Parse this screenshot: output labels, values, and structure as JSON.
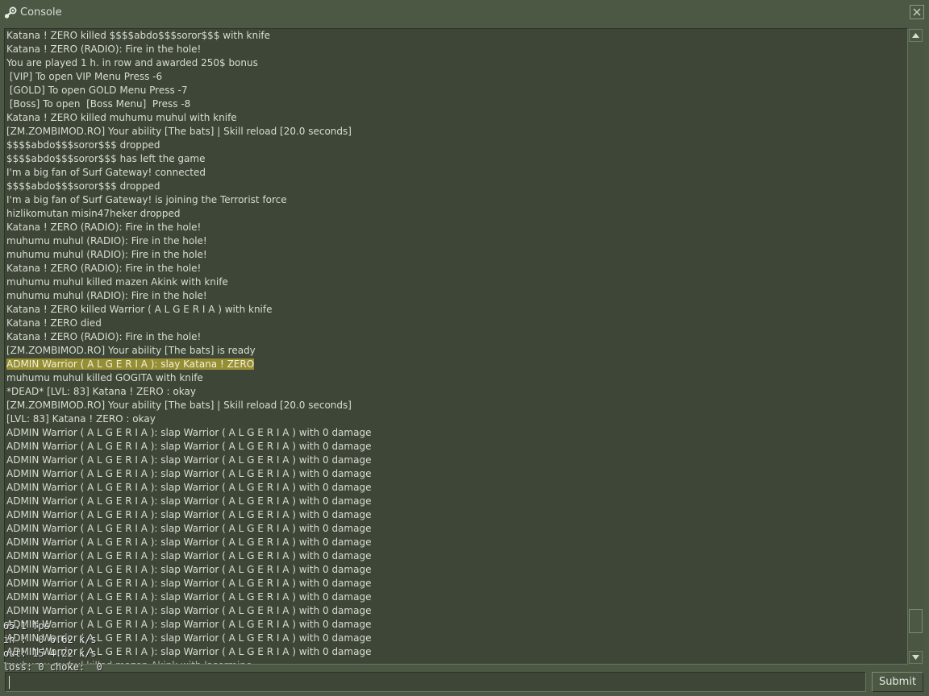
{
  "window": {
    "title": "Console",
    "title_icon": "steam-icon",
    "close_icon": "close-icon"
  },
  "log": {
    "highlight_color": "#958e34",
    "lines": [
      "Katana ! ZERO killed $$$$abdo$$$soror$$$ with knife",
      "Katana ! ZERO (RADIO): Fire in the hole!",
      "You are played 1 h. in row and awarded 250$ bonus",
      " [VIP] To open VIP Menu Press -6",
      " [GOLD] To open GOLD Menu Press -7",
      " [Boss] To open  [Boss Menu]  Press -8",
      "Katana ! ZERO killed muhumu muhul with knife",
      "[ZM.ZOMBIMOD.RO] Your ability [The bats] | Skill reload [20.0 seconds]",
      "$$$$abdo$$$soror$$$ dropped",
      "$$$$abdo$$$soror$$$ has left the game",
      "I'm a big fan of Surf Gateway! connected",
      "$$$$abdo$$$soror$$$ dropped",
      "I'm a big fan of Surf Gateway! is joining the Terrorist force",
      "hizlikomutan misin47heker dropped",
      "Katana ! ZERO (RADIO): Fire in the hole!",
      "muhumu muhul (RADIO): Fire in the hole!",
      "muhumu muhul (RADIO): Fire in the hole!",
      "Katana ! ZERO (RADIO): Fire in the hole!",
      "muhumu muhul killed mazen Akink with knife",
      "muhumu muhul (RADIO): Fire in the hole!",
      "Katana ! ZERO killed Warrior ( A L G E R I A ) with knife",
      "Katana ! ZERO died",
      "Katana ! ZERO (RADIO): Fire in the hole!",
      "[ZM.ZOMBIMOD.RO] Your ability [The bats] is ready",
      "ADMIN Warrior ( A L G E R I A ): slay Katana ! ZERO",
      "muhumu muhul killed GOGITA with knife",
      "*DEAD* [LVL: 83] Katana ! ZERO : okay",
      "[ZM.ZOMBIMOD.RO] Your ability [The bats] | Skill reload [20.0 seconds]",
      "[LVL: 83] Katana ! ZERO : okay",
      "ADMIN Warrior ( A L G E R I A ): slap Warrior ( A L G E R I A ) with 0 damage",
      "ADMIN Warrior ( A L G E R I A ): slap Warrior ( A L G E R I A ) with 0 damage",
      "ADMIN Warrior ( A L G E R I A ): slap Warrior ( A L G E R I A ) with 0 damage",
      "ADMIN Warrior ( A L G E R I A ): slap Warrior ( A L G E R I A ) with 0 damage",
      "ADMIN Warrior ( A L G E R I A ): slap Warrior ( A L G E R I A ) with 0 damage",
      "ADMIN Warrior ( A L G E R I A ): slap Warrior ( A L G E R I A ) with 0 damage",
      "ADMIN Warrior ( A L G E R I A ): slap Warrior ( A L G E R I A ) with 0 damage",
      "ADMIN Warrior ( A L G E R I A ): slap Warrior ( A L G E R I A ) with 0 damage",
      "ADMIN Warrior ( A L G E R I A ): slap Warrior ( A L G E R I A ) with 0 damage",
      "ADMIN Warrior ( A L G E R I A ): slap Warrior ( A L G E R I A ) with 0 damage",
      "ADMIN Warrior ( A L G E R I A ): slap Warrior ( A L G E R I A ) with 0 damage",
      "ADMIN Warrior ( A L G E R I A ): slap Warrior ( A L G E R I A ) with 0 damage",
      "ADMIN Warrior ( A L G E R I A ): slap Warrior ( A L G E R I A ) with 0 damage",
      "ADMIN Warrior ( A L G E R I A ): slap Warrior ( A L G E R I A ) with 0 damage",
      "ADMIN Warrior ( A L G E R I A ): slap Warrior ( A L G E R I A ) with 0 damage",
      "ADMIN Warrior ( A L G E R I A ): slap Warrior ( A L G E R I A ) with 0 damage",
      "ADMIN Warrior ( A L G E R I A ): slap Warrior ( A L G E R I A ) with 0 damage"
    ],
    "cut_line": "muhumu muhul killed mazen Akink with lasermine"
  },
  "netgraph": {
    "fps": "65.1 fps",
    "in": "in :  0 6.62 k/s",
    "out": "out: 15 4.22 k/s",
    "loss": "loss: 0 choke:  0"
  },
  "command": {
    "value": "",
    "submit_label": "Submit"
  },
  "scrollbar": {
    "position_fraction": 0.97,
    "up_icon": "arrow-up-icon",
    "down_icon": "arrow-down-icon"
  }
}
